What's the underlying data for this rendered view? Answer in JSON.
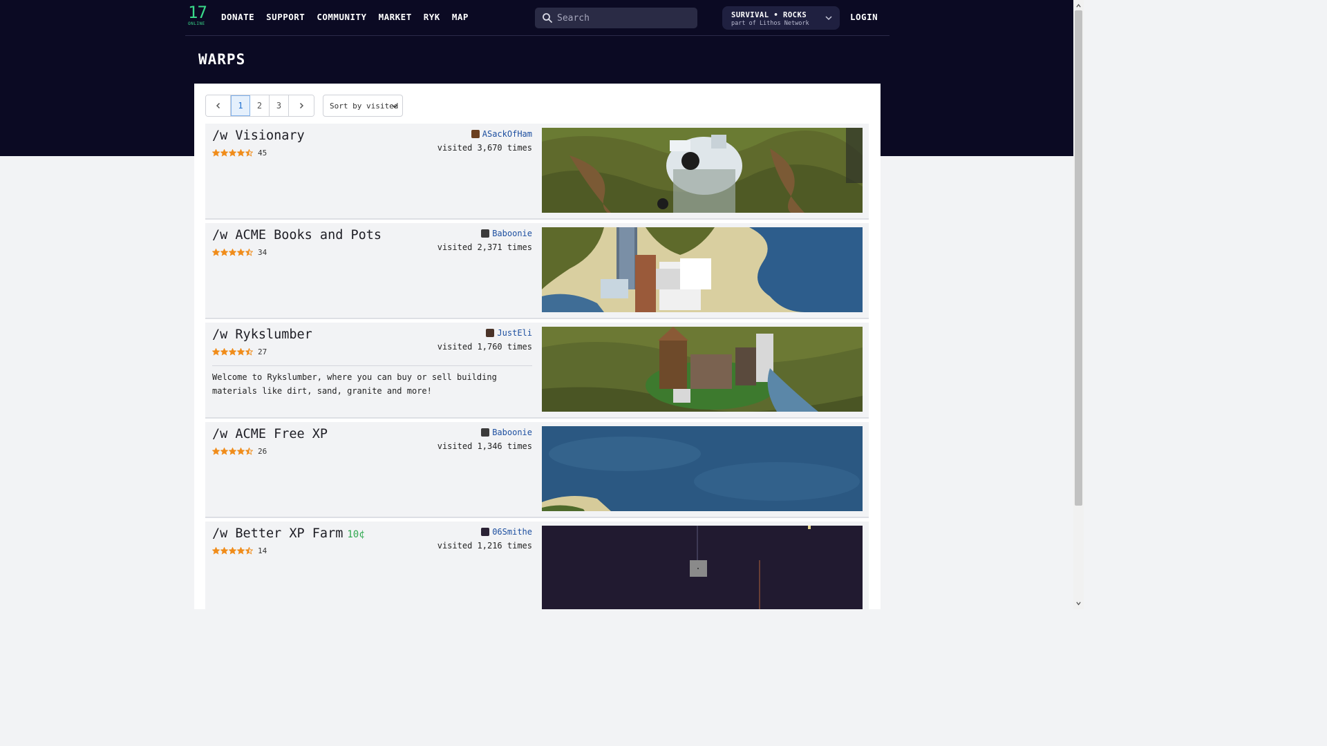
{
  "nav": {
    "logo_number": "17",
    "logo_subtext": "ONLINE",
    "items": [
      "DONATE",
      "SUPPORT",
      "COMMUNITY",
      "MARKET",
      "RYK",
      "MAP"
    ],
    "search_placeholder": "Search",
    "server_name": "SURVIVAL • ROCKS",
    "server_subtitle": "part of Lithos Network",
    "login": "LOGIN"
  },
  "page": {
    "title": "WARPS"
  },
  "pagination": {
    "prev_icon": "chevron-left-icon",
    "pages": [
      "1",
      "2",
      "3"
    ],
    "current": "1",
    "next_icon": "chevron-right-icon"
  },
  "sort": {
    "label": "Sort by visited"
  },
  "warps": [
    {
      "name": "/w Visionary",
      "price": "",
      "rating": "45",
      "stars": 4.5,
      "owner": "ASackOfHam",
      "visits": "visited 3,670 times",
      "description": "",
      "thumbnail": "grassland-castle"
    },
    {
      "name": "/w ACME Books and Pots",
      "price": "",
      "rating": "34",
      "stars": 4.5,
      "owner": "Baboonie",
      "visits": "visited 2,371 times",
      "description": "",
      "thumbnail": "desert-coast-tower"
    },
    {
      "name": "/w Rykslumber",
      "price": "",
      "rating": "27",
      "stars": 4.5,
      "owner": "JustEli",
      "visits": "visited 1,760 times",
      "description": "Welcome to Rykslumber, where you can buy or sell building materials like dirt, sand, granite and more!",
      "thumbnail": "floating-island-town"
    },
    {
      "name": "/w ACME Free XP",
      "price": "",
      "rating": "26",
      "stars": 4.5,
      "owner": "Baboonie",
      "visits": "visited 1,346 times",
      "description": "",
      "thumbnail": "ocean"
    },
    {
      "name": "/w Better XP Farm",
      "price": "10¢",
      "rating": "14",
      "stars": 4.5,
      "owner": "06Smithe",
      "visits": "visited 1,216 times",
      "description": "",
      "thumbnail": "dark-void"
    }
  ],
  "colors": {
    "header_bg": "#0b0a23",
    "accent_green": "#39d98a",
    "star": "#f08c1a",
    "link": "#1d4fa0",
    "price": "#2fa84f"
  }
}
